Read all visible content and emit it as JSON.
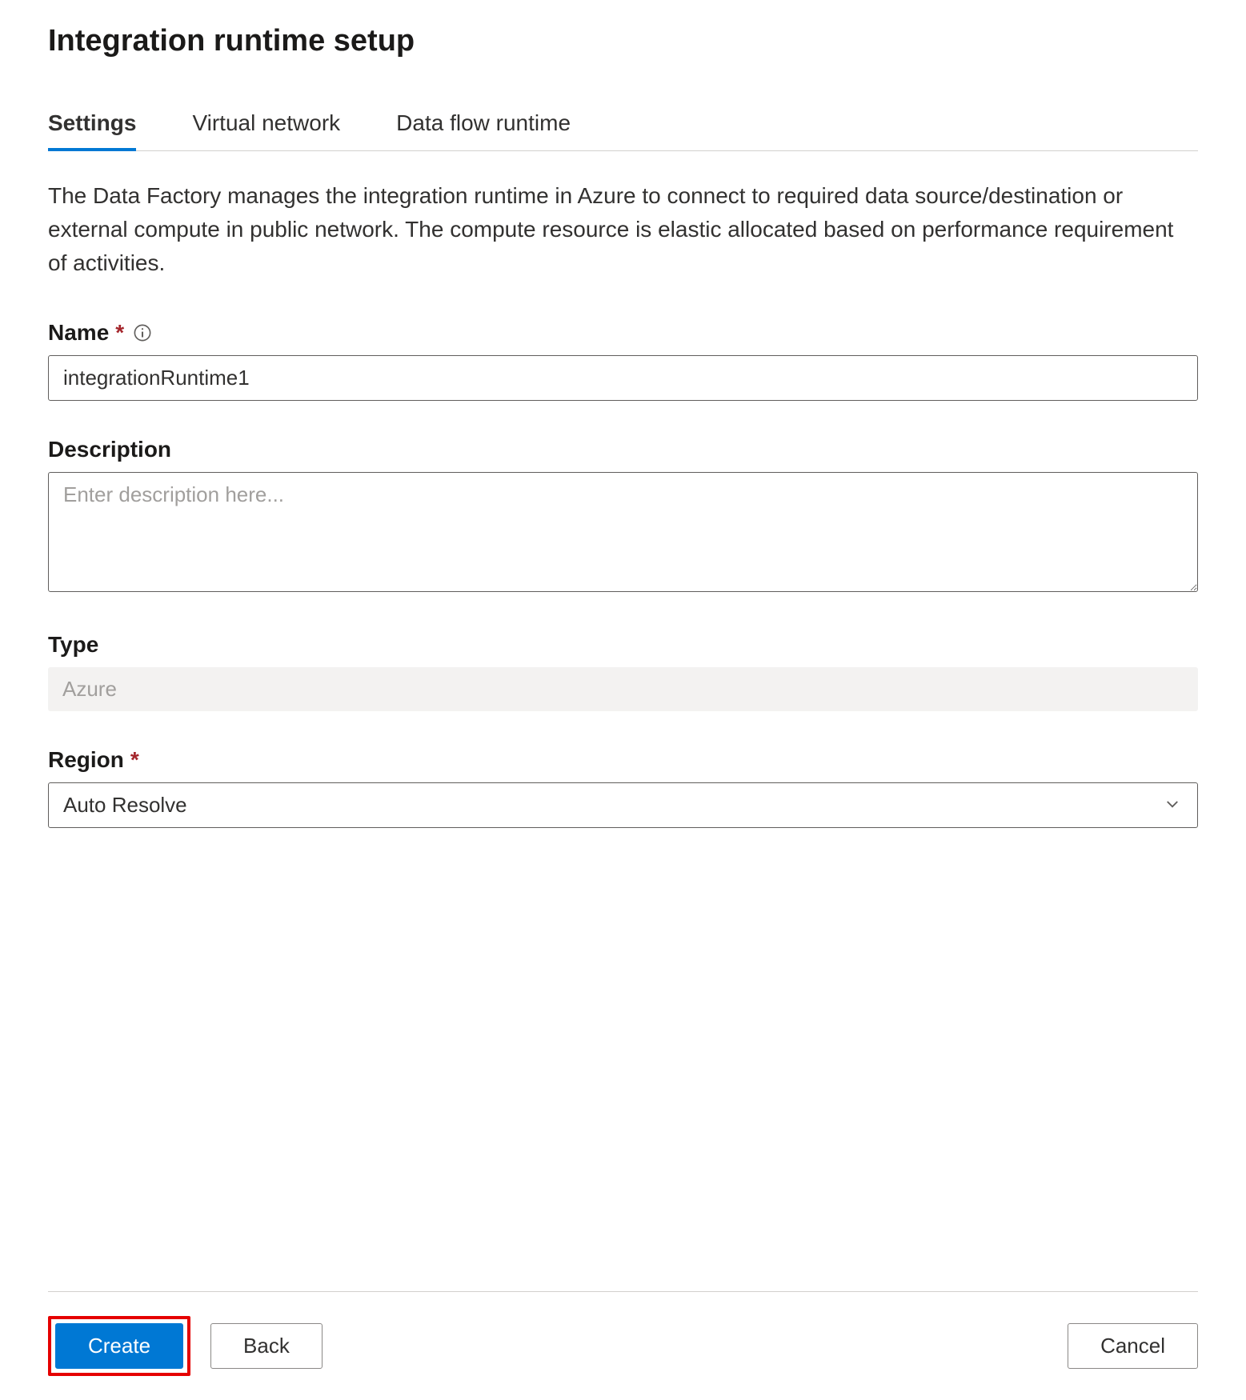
{
  "title": "Integration runtime setup",
  "tabs": {
    "settings": "Settings",
    "virtualNetwork": "Virtual network",
    "dataFlowRuntime": "Data flow runtime"
  },
  "description": "The Data Factory manages the integration runtime in Azure to connect to required data source/destination or external compute in public network. The compute resource is elastic allocated based on performance requirement of activities.",
  "fields": {
    "name": {
      "label": "Name",
      "value": "integrationRuntime1"
    },
    "description": {
      "label": "Description",
      "placeholder": "Enter description here..."
    },
    "type": {
      "label": "Type",
      "value": "Azure"
    },
    "region": {
      "label": "Region",
      "value": "Auto Resolve"
    }
  },
  "buttons": {
    "create": "Create",
    "back": "Back",
    "cancel": "Cancel"
  }
}
